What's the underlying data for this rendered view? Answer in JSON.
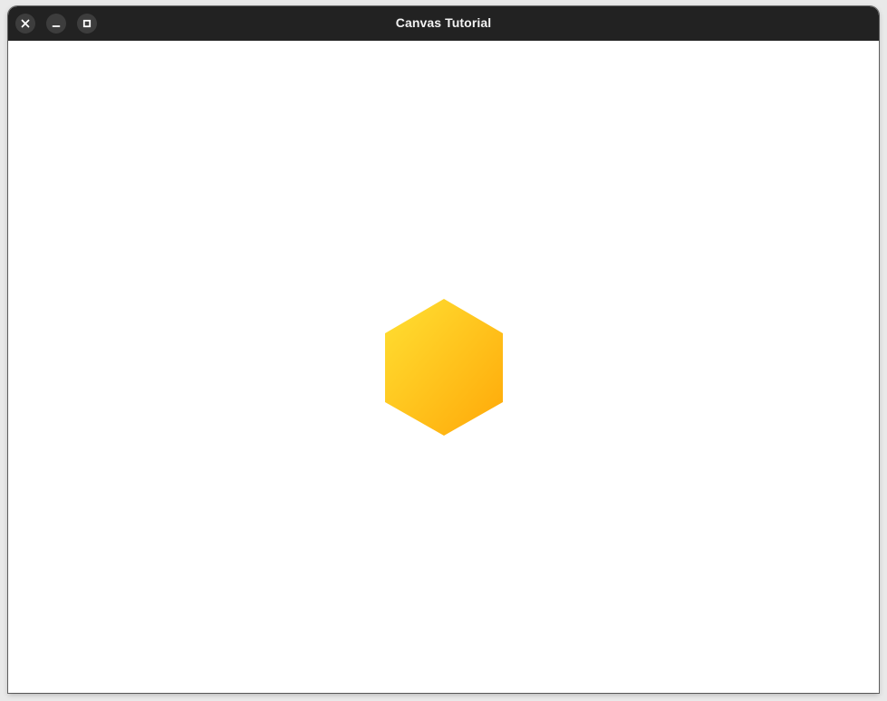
{
  "window": {
    "title": "Canvas Tutorial",
    "controls": {
      "close_icon": "close-icon",
      "minimize_icon": "minimize-icon",
      "maximize_icon": "maximize-icon"
    }
  },
  "canvas": {
    "background": "#ffffff",
    "shape": {
      "type": "hexagon",
      "gradient_start": "#ffe033",
      "gradient_end": "#ffa808"
    }
  },
  "colors": {
    "titlebar": "#222222",
    "title_text": "#f2f2f2",
    "control_bg": "#3d3d3d"
  }
}
